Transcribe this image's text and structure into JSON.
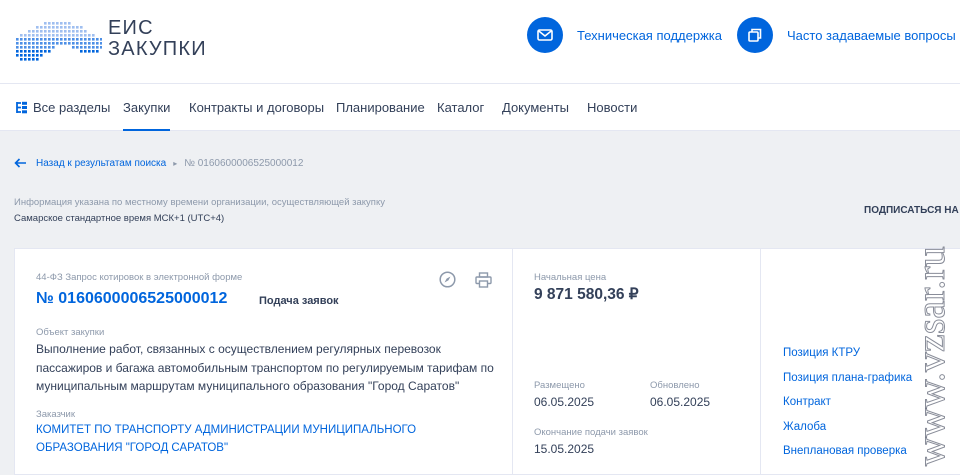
{
  "header": {
    "logo_text_line1": "ЕИС",
    "logo_text_line2": "ЗАКУПКИ",
    "support_label": "Техническая поддержка",
    "faq_label": "Часто задаваемые вопросы",
    "accent_color": "#0065dd"
  },
  "nav": {
    "items": [
      {
        "label": "Все разделы"
      },
      {
        "label": "Закупки"
      },
      {
        "label": "Контракты и договоры"
      },
      {
        "label": "Планирование"
      },
      {
        "label": "Каталог"
      },
      {
        "label": "Документы"
      },
      {
        "label": "Новости"
      }
    ],
    "active": "Закупки"
  },
  "breadcrumb": {
    "back_label": "Назад к результатам поиска",
    "current": "№ 0160600006525000012"
  },
  "timezone": {
    "note": "Информация указана по местному времени организации, осуществляющей закупку",
    "value": "Самарское стандартное время МСК+1 (UTC+4)"
  },
  "subscribe_label": "ПОДПИСАТЬСЯ НА",
  "card": {
    "law_type": "44-ФЗ Запрос котировок в электронной форме",
    "reg_number": "№ 0160600006525000012",
    "status": "Подача заявок",
    "object_label": "Объект закупки",
    "object_text": "Выполнение работ, связанных с осуществлением регулярных перевозок пассажиров и багажа автомобильным транспортом по регулируемым тарифам по муниципальным маршрутам муниципального образования \"Город Саратов\"",
    "customer_label": "Заказчик",
    "customer_name": "КОМИТЕТ ПО ТРАНСПОРТУ АДМИНИСТРАЦИИ МУНИЦИПАЛЬНОГО ОБРАЗОВАНИЯ \"ГОРОД САРАТОВ\"",
    "price_label": "Начальная цена",
    "price_value": "9 871 580,36 ₽",
    "placed_label": "Размещено",
    "placed_value": "06.05.2025",
    "updated_label": "Обновлено",
    "updated_value": "06.05.2025",
    "deadline_label": "Окончание подачи заявок",
    "deadline_value": "15.05.2025",
    "side_links": [
      {
        "label": "Позиция КТРУ"
      },
      {
        "label": "Позиция плана-графика"
      },
      {
        "label": "Контракт"
      },
      {
        "label": "Жалоба"
      },
      {
        "label": "Внеплановая проверка"
      }
    ]
  },
  "watermark": "www.vzsar.ru",
  "icons": {
    "support": "envelope-icon",
    "faq": "windows-icon",
    "all_sections": "sections-icon",
    "back": "arrow-left-icon",
    "card_actions": [
      "compass-icon",
      "printer-icon"
    ]
  }
}
